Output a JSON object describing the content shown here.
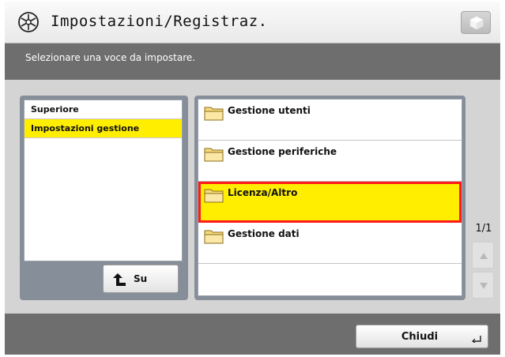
{
  "header": {
    "title": "Impostazioni/Registraz.",
    "icon": "settings-gear-icon",
    "device_button_icon": "device-status-icon"
  },
  "instruction": {
    "text": "Selezionare una voce da impostare."
  },
  "tree": {
    "items": [
      {
        "label": "Superiore",
        "selected": false
      },
      {
        "label": "Impostazioni gestione",
        "selected": true
      }
    ],
    "up_button_label": "Su",
    "up_button_icon": "up-return-arrow-icon"
  },
  "list": {
    "items": [
      {
        "label": "Gestione utenti",
        "icon": "folder-icon",
        "highlighted": false
      },
      {
        "label": "Gestione periferiche",
        "icon": "folder-icon",
        "highlighted": false
      },
      {
        "label": "Licenza/Altro",
        "icon": "folder-icon",
        "highlighted": true
      },
      {
        "label": "Gestione dati",
        "icon": "folder-icon",
        "highlighted": false
      }
    ]
  },
  "pager": {
    "page": "1/1"
  },
  "footer": {
    "close_label": "Chiudi",
    "close_icon": "enter-arrow-icon"
  },
  "colors": {
    "selection_yellow": "#ffee00",
    "highlight_border_red": "#ff1a1a",
    "panel_gray": "#868f99",
    "bar_dark": "#6e6e6e"
  }
}
